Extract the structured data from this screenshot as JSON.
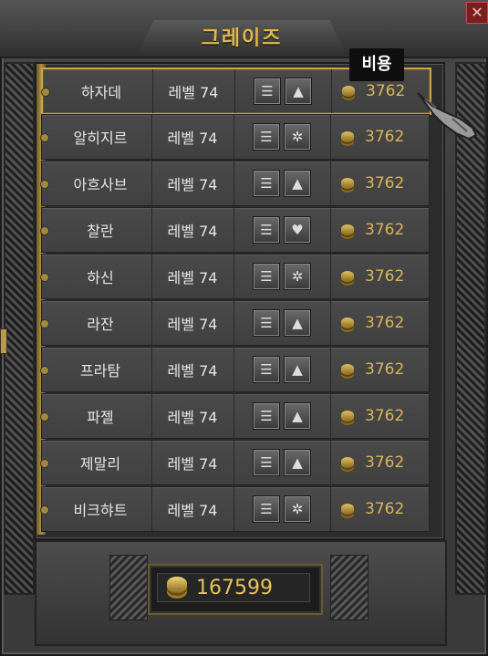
{
  "window": {
    "title": "그레이즈",
    "close_label": "✕"
  },
  "tooltip": {
    "text": "비용"
  },
  "rows": [
    {
      "name": "하자데",
      "level": "레벨 74",
      "cost": "3762"
    },
    {
      "name": "알히지르",
      "level": "레벨 74",
      "cost": "3762"
    },
    {
      "name": "아흐사브",
      "level": "레벨 74",
      "cost": "3762"
    },
    {
      "name": "찰란",
      "level": "레벨 74",
      "cost": "3762"
    },
    {
      "name": "하신",
      "level": "레벨 74",
      "cost": "3762"
    },
    {
      "name": "라잔",
      "level": "레벨 74",
      "cost": "3762"
    },
    {
      "name": "프라탐",
      "level": "레벨 74",
      "cost": "3762"
    },
    {
      "name": "파젤",
      "level": "레벨 74",
      "cost": "3762"
    },
    {
      "name": "제말리",
      "level": "레벨 74",
      "cost": "3762"
    },
    {
      "name": "비크햐트",
      "level": "레벨 74",
      "cost": "3762"
    }
  ],
  "icons": {
    "upgrade": "stairs-icon",
    "emblems": [
      "tree-icon",
      "gear-icon",
      "tree-icon",
      "heart-icon",
      "gear-icon",
      "tree-icon",
      "tree-icon",
      "tree-icon",
      "tree-icon",
      "gear-icon"
    ]
  },
  "gold": {
    "amount": "167599"
  },
  "colors": {
    "accent": "#d7b65a",
    "selected_border": "#c8a645"
  }
}
